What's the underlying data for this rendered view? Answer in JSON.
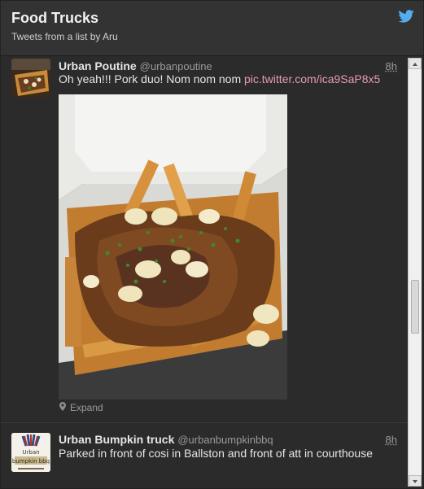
{
  "header": {
    "title": "Food Trucks",
    "subtitle": "Tweets from a list by Aru"
  },
  "tweets": [
    {
      "name": "Urban Poutine",
      "handle": "@urbanpoutine",
      "time": "8h",
      "text": "Oh yeah!!! Pork duo! Nom nom nom ",
      "link": "pic.twitter.com/ica9SaP8x5",
      "expand_label": "Expand"
    },
    {
      "name": "Urban Bumpkin truck",
      "handle": "@urbanbumpkinbbq",
      "time": "8h",
      "text": "Parked in front of cosi in Ballston and front of att in courthouse",
      "avatar_text": [
        "Urban",
        "bumpkin bbq"
      ]
    }
  ],
  "colors": {
    "background": "#2b2b2b",
    "link": "#e89ab0",
    "twitter_blue": "#55acee"
  }
}
